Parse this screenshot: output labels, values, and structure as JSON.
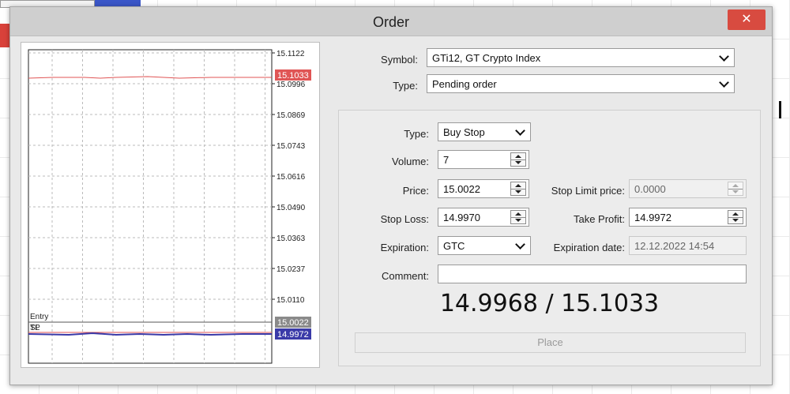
{
  "window": {
    "title": "Order",
    "close_icon": "✕"
  },
  "chart": {
    "price_levels": [
      "15.1122",
      "15.0996",
      "15.0869",
      "15.0743",
      "15.0616",
      "15.0490",
      "15.0363",
      "15.0237",
      "15.0110"
    ],
    "ask_tag": "15.1033",
    "entry_tag": "15.0022",
    "tp_tag": "14.9972",
    "entry_label": "Entry",
    "sl_label": "SL",
    "tp_label": "TP",
    "ask_color": "#e05555",
    "entry_color": "#8a8a8a",
    "tp_color": "#3a3aa8"
  },
  "form": {
    "symbol_label": "Symbol:",
    "symbol_value": "GTi12, GT Crypto Index",
    "type_label": "Type:",
    "type_value": "Pending order",
    "order_type_label": "Type:",
    "order_type_value": "Buy Stop",
    "volume_label": "Volume:",
    "volume_value": "7",
    "price_label": "Price:",
    "price_value": "15.0022",
    "stop_limit_label": "Stop Limit price:",
    "stop_limit_value": "0.0000",
    "stop_loss_label": "Stop Loss:",
    "stop_loss_value": "14.9970",
    "take_profit_label": "Take Profit:",
    "take_profit_value": "14.9972",
    "expiration_label": "Expiration:",
    "expiration_value": "GTC",
    "expiration_date_label": "Expiration date:",
    "expiration_date_value": "12.12.2022 14:54",
    "comment_label": "Comment:",
    "comment_value": "",
    "quote": "14.9968 / 15.1033",
    "place_label": "Place"
  }
}
